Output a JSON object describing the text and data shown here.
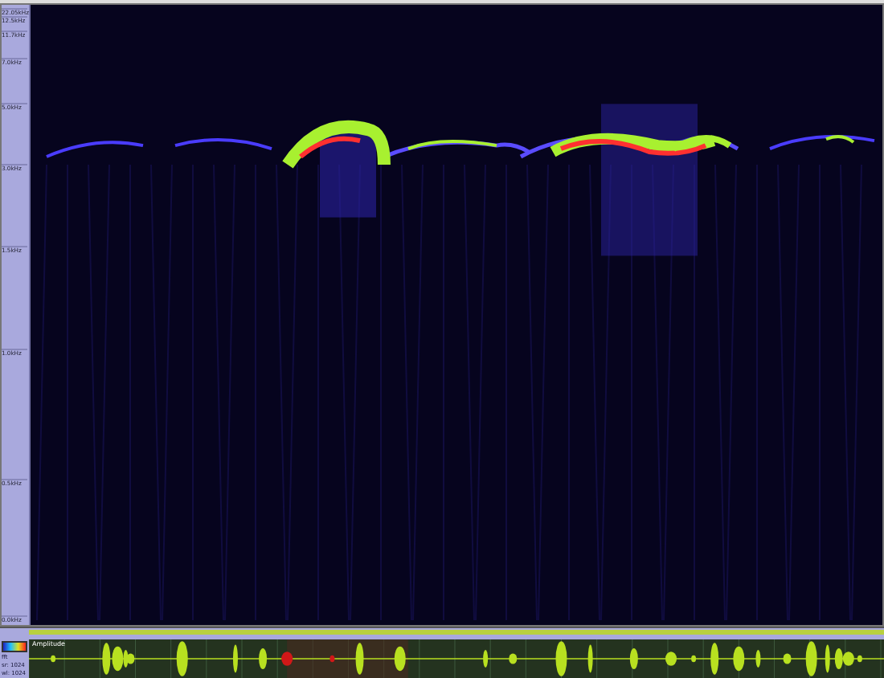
{
  "frequency_axis": {
    "labels": [
      "22.05kHz",
      "12.5kHz",
      "11.7kHz",
      "7.0kHz",
      "5.0kHz",
      "3.0kHz",
      "1.5kHz",
      "1.0kHz",
      "0.5kHz",
      "0.0kHz"
    ]
  },
  "waveform": {
    "label": "Amplitude",
    "info": [
      "fft",
      "sr: 1024",
      "wl: 1024"
    ]
  }
}
